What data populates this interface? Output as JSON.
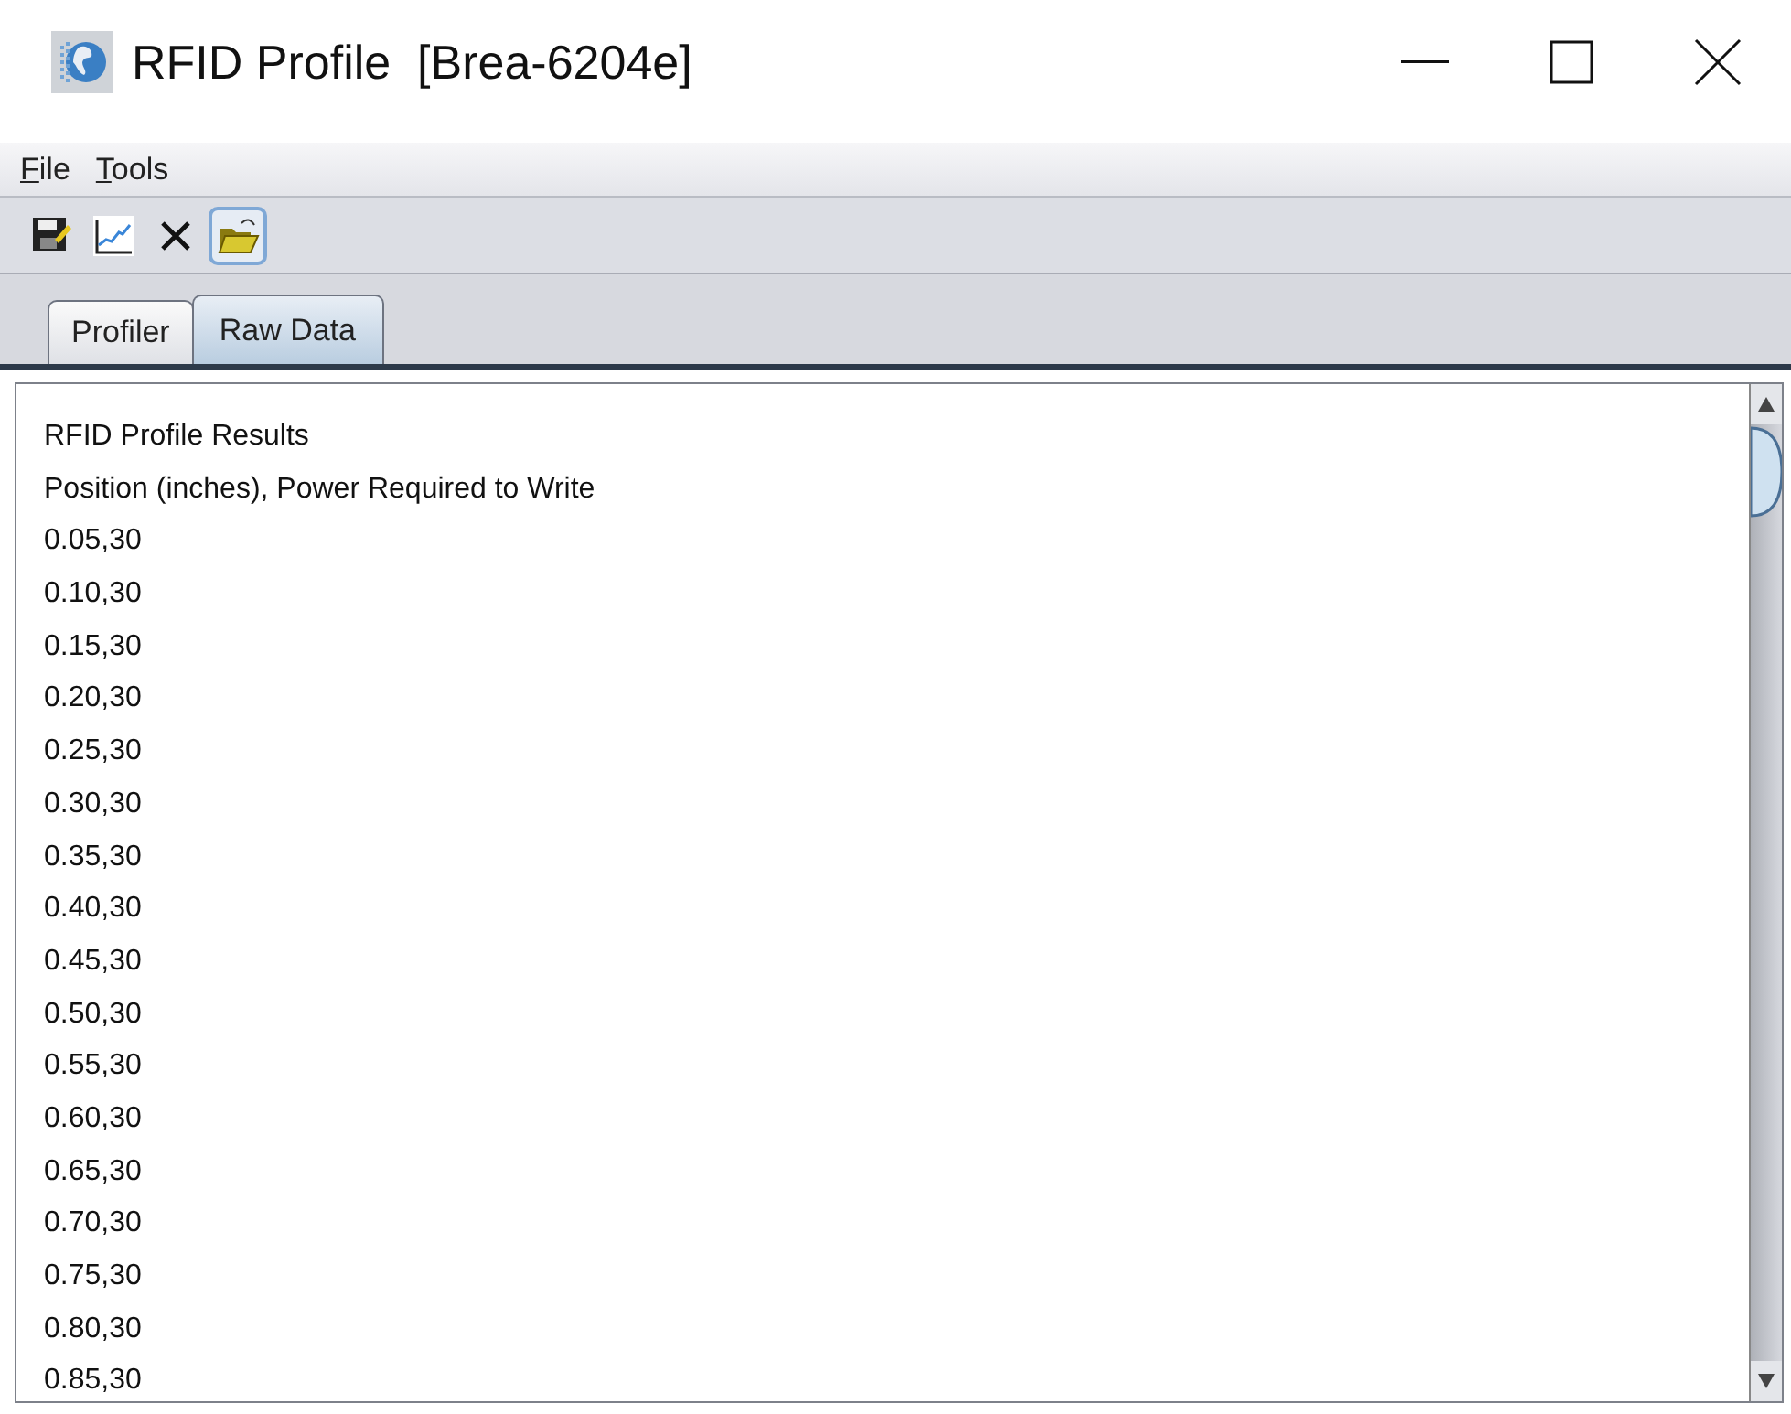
{
  "window": {
    "title": "RFID Profile  [Brea-6204e]"
  },
  "menu": [
    {
      "label": "File"
    },
    {
      "label": "Tools"
    }
  ],
  "toolbar": [
    {
      "kind": "save",
      "selected": false
    },
    {
      "kind": "chart",
      "selected": false
    },
    {
      "kind": "delete",
      "selected": false
    },
    {
      "kind": "open",
      "selected": true
    }
  ],
  "tabs": [
    {
      "label": "Profiler",
      "selected": false
    },
    {
      "label": "Raw Data",
      "selected": true
    }
  ],
  "raw_data": {
    "lines": [
      "RFID Profile Results",
      "Position (inches), Power Required to Write",
      "0.05,30",
      "0.10,30",
      "0.15,30",
      "0.20,30",
      "0.25,30",
      "0.30,30",
      "0.35,30",
      "0.40,30",
      "0.45,30",
      "0.50,30",
      "0.55,30",
      "0.60,30",
      "0.65,30",
      "0.70,30",
      "0.75,30",
      "0.80,30",
      "0.85,30"
    ]
  }
}
